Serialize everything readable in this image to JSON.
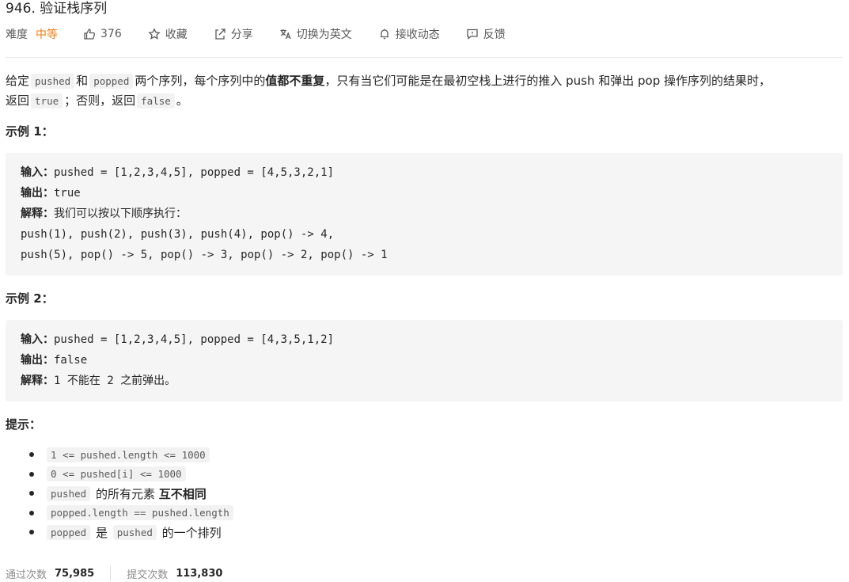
{
  "problem": {
    "title": "946. 验证栈序列"
  },
  "meta": {
    "difficulty_label": "难度",
    "difficulty_value": "中等",
    "likes": "376",
    "favorite": "收藏",
    "share": "分享",
    "translate": "切换为英文",
    "subscribe": "接收动态",
    "feedback": "反馈"
  },
  "description": {
    "t1": "给定",
    "c1": "pushed",
    "t2": "和",
    "c2": "popped",
    "t3": "两个序列，每个序列中的",
    "b1": "值都不重复",
    "t4": "，只有当它们可能是在最初空栈上进行的推入 push 和弹出 pop 操作序列的结果时，",
    "t5": "返回",
    "c3": "true",
    "t6": "；否则，返回",
    "c4": "false",
    "t7": "。"
  },
  "example1": {
    "heading": "示例 1：",
    "input_label": "输入：",
    "input_value": "pushed = [1,2,3,4,5], popped = [4,5,3,2,1]",
    "output_label": "输出：",
    "output_value": "true",
    "explain_label": "解释：",
    "explain_value": "我们可以按以下顺序执行：",
    "line4": "push(1), push(2), push(3), push(4), pop() -> 4,",
    "line5": "push(5), pop() -> 5, pop() -> 3, pop() -> 2, pop() -> 1"
  },
  "example2": {
    "heading": "示例 2：",
    "input_label": "输入：",
    "input_value": "pushed = [1,2,3,4,5], popped = [4,3,5,1,2]",
    "output_label": "输出：",
    "output_value": "false",
    "explain_label": "解释：",
    "explain_num1": "1",
    "explain_text1": "不能在",
    "explain_num2": "2",
    "explain_text2": "之前弹出。"
  },
  "hints": {
    "heading": "提示：",
    "h1": "1 <= pushed.length <= 1000",
    "h2": "0 <= pushed[i] <= 1000",
    "h3_code": "pushed",
    "h3_text": "的所有元素",
    "h3_bold": "互不相同",
    "h4": "popped.length == pushed.length",
    "h5_code1": "popped",
    "h5_text1": "是",
    "h5_code2": "pushed",
    "h5_text2": "的一个排列"
  },
  "stats": {
    "accepted_label": "通过次数",
    "accepted_value": "75,985",
    "submissions_label": "提交次数",
    "submissions_value": "113,830"
  }
}
